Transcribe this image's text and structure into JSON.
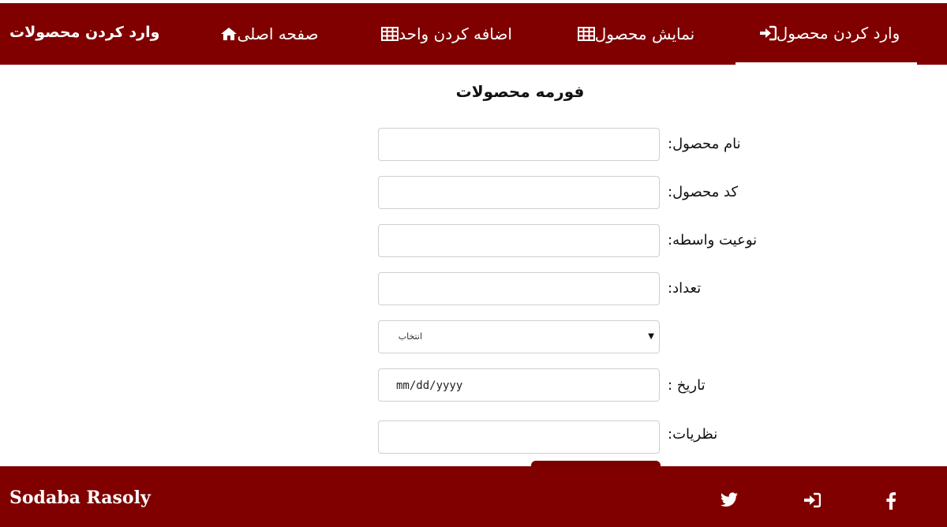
{
  "brand": "وارد کردن محصولات",
  "nav": {
    "home": "صفحه اصلی",
    "add_unit": "اضافه کردن واحد",
    "show_product": "نمایش محصول",
    "enter_product": "وارد کردن محصول"
  },
  "form": {
    "title": "فورمه محصولات",
    "product_name_label": "نام محصول:",
    "product_code_label": "کد محصول:",
    "unit_type_label": "نوعیت واسطه:",
    "count_label": "تعداد:",
    "select_value": "انتخاب",
    "date_label": "تاریخ :",
    "date_placeholder": "mm/dd/yyyy",
    "comments_label": "نظریات:"
  },
  "footer": {
    "name": "Sodaba Rasoly"
  },
  "icons": {
    "home": "home-icon",
    "table": "table-icon",
    "login": "sign-in-icon",
    "twitter": "twitter-icon",
    "facebook": "facebook-icon"
  },
  "colors": {
    "primary": "#800000",
    "text_on_primary": "#ffffff",
    "field_border": "#cfcfcf"
  }
}
